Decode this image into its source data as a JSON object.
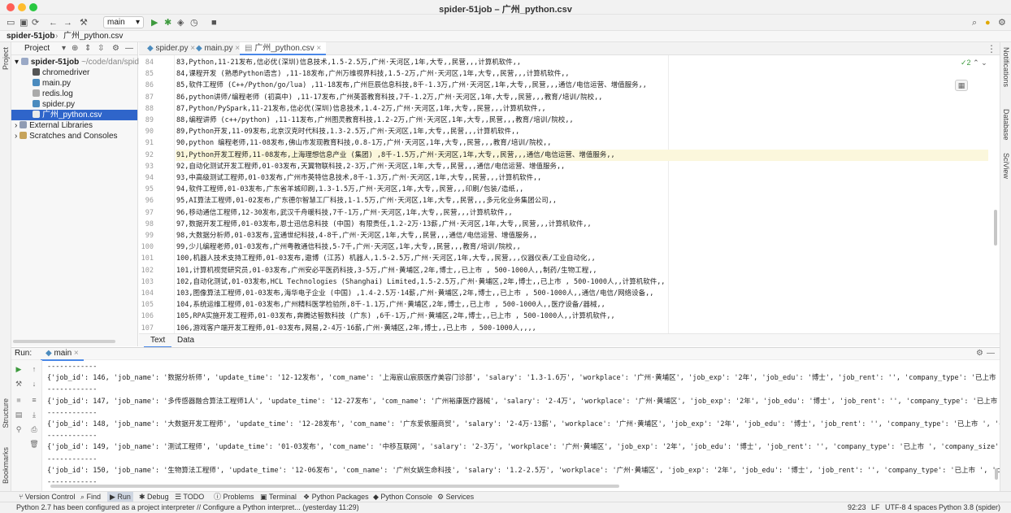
{
  "window": {
    "title": "spider-51job – 广州_python.csv"
  },
  "toolbar": {
    "run_config": "main"
  },
  "nav": {
    "project": "spider-51job",
    "file": "广州_python.csv"
  },
  "left_strip": {
    "project": "Project",
    "structure": "Structure",
    "bookmarks": "Bookmarks"
  },
  "right_strip": {
    "notifications": "Notifications",
    "database": "Database",
    "sciview": "SciView"
  },
  "project_panel": {
    "title": "Project",
    "root": "spider-51job",
    "root_path": "~/code/dan/spider",
    "items": [
      "chromedriver",
      "main.py",
      "redis.log",
      "spider.py",
      "广州_python.csv"
    ],
    "external": "External Libraries",
    "scratches": "Scratches and Consoles"
  },
  "editor": {
    "tabs": [
      "spider.py",
      "main.py",
      "广州_python.csv"
    ],
    "inspection_count": "2",
    "bottom_tabs": [
      "Text",
      "Data"
    ],
    "lines": [
      {
        "n": "84",
        "t": "83,Python,11-21发布,信必优(深圳)信息技术,1.5-2.5万,广州·天河区,1年,大专,,民营,,,计算机软件,,"
      },
      {
        "n": "85",
        "t": "84,课程开发 (熟悉Python语言) ,11-18发布,广州万维视界科技,1.5-2万,广州·天河区,1年,大专,,民营,,,计算机软件,,"
      },
      {
        "n": "86",
        "t": "85,软件工程师 (C++/Python/go/lua) ,11-18发布,广州巨辰信息科技,8千-1.3万,广州·天河区,1年,大专,,民营,,,通信/电信运营、增值服务,,"
      },
      {
        "n": "87",
        "t": "86,python讲师/编程老师 (初高中) ,11-17发布,广州英荟教育科技,7千-1.2万,广州·天河区,1年,大专,,民营,,,教育/培训/院校,,"
      },
      {
        "n": "88",
        "t": "87,Python/PySpark,11-21发布,信必优(深圳)信息技术,1.4-2万,广州·天河区,1年,大专,,民营,,,计算机软件,,"
      },
      {
        "n": "89",
        "t": "88,编程讲师 (c++/python) ,11-11发布,广州图灵教育科技,1.2-2万,广州·天河区,1年,大专,,民营,,,教育/培训/院校,,"
      },
      {
        "n": "90",
        "t": "89,Python开发,11-09发布,北京汉克时代科技,1.3-2.5万,广州·天河区,1年,大专,,民营,,,计算机软件,,"
      },
      {
        "n": "91",
        "t": "90,python 编程老师,11-08发布,佛山市发现教育科技,0.8-1万,广州·天河区,1年,大专,,民营,,,教育/培训/院校,,"
      },
      {
        "n": "92",
        "t": "91,Python开发工程师,11-08发布,上海理想信息产业 (集团) ,8千-1.5万,广州·天河区,1年,大专,,民营,,,通信/电信运营、增值服务,,"
      },
      {
        "n": "93",
        "t": "92,自动化测试开发工程师,01-03发布,天翼物联科技,2-3万,广州·天河区,1年,大专,,民营,,,通信/电信运营、增值服务,,"
      },
      {
        "n": "94",
        "t": "93,中高级测试工程师,01-03发布,广州市英特信息技术,8千-1.3万,广州·天河区,1年,大专,,民营,,,计算机软件,,"
      },
      {
        "n": "95",
        "t": "94,软件工程师,01-03发布,广东省羊城印刷,1.3-1.5万,广州·天河区,1年,大专,,民营,,,印刷/包装/造纸,,"
      },
      {
        "n": "96",
        "t": "95,AI算法工程师,01-02发布,广东德尔智慧工厂科技,1-1.5万,广州·天河区,1年,大专,,民营,,,多元化业务集团公司,,"
      },
      {
        "n": "97",
        "t": "96,移动通信工程师,12-30发布,武汉千舟暖科技,7千-1万,广州·天河区,1年,大专,,民营,,,计算机软件,,"
      },
      {
        "n": "98",
        "t": "97,数据开发工程师,01-03发布,恩士迅信息科技 (中国) 有限责任,1.2-2万·13薪,广州·天河区,1年,大专,,民营,,,计算机软件,,"
      },
      {
        "n": "99",
        "t": "98,大数据分析师,01-03发布,宜通世纪科技,4-8千,广州·天河区,1年,大专,,民营,,,通信/电信运营、增值服务,,"
      },
      {
        "n": "100",
        "t": "99,少儿编程老师,01-03发布,广州粤教通信科技,5-7千,广州·天河区,1年,大专,,民营,,,教育/培训/院校,,"
      },
      {
        "n": "101",
        "t": "100,机器人技术支持工程师,01-03发布,遨博 (江苏) 机器人,1.5-2.5万,广州·天河区,1年,大专,,民营,,,仪器仪表/工业自动化,,"
      },
      {
        "n": "102",
        "t": "101,计算机视觉研究员,01-03发布,广州安必平医药科技,3-5万,广州·黄埔区,2年,博士,,已上市 , 500-1000人,,制药/生物工程,,"
      },
      {
        "n": "103",
        "t": "102,自动化测试,01-03发布,HCL Technologies (Shanghai) Limited,1.5-2.5万,广州·黄埔区,2年,博士,,已上市 , 500-1000人,,计算机软件,,"
      },
      {
        "n": "104",
        "t": "103,图像算法工程师,01-03发布,海华电子企业 (中国) ,1.4-2.5万·14薪,广州·黄埔区,2年,博士,,已上市 , 500-1000人,,通信/电信/网络设备,,"
      },
      {
        "n": "105",
        "t": "104,系统运维工程师,01-03发布,广州精科医学检验所,8千-1.1万,广州·黄埔区,2年,博士,,已上市 , 500-1000人,,医疗设备/器械,,"
      },
      {
        "n": "106",
        "t": "105,RPA实施开发工程师,01-03发布,奔腾达智数科技 (广东) ,6千-1万,广州·黄埔区,2年,博士,,已上市 , 500-1000人,,计算机软件,,"
      },
      {
        "n": "107",
        "t": "106,游戏客户端开发工程师,01-03发布,网易,2-4万·16薪,广州·黄埔区,2年,博士,,已上市 , 500-1000人,,,,"
      }
    ]
  },
  "run_panel": {
    "label": "Run:",
    "config": "main",
    "lines": [
      "------------",
      "{'job_id': 146, 'job_name': '数据分析师', 'update_time': '12-12发布', 'com_name': '上海宸山宸辰医疗美容门诊部', 'salary': '1.3-1.6万', 'workplace': '广州·黄埔区', 'job_exp': '2年', 'job_edu': '博士', 'job_rent': '', 'company_type': '已上市 ',",
      "------------",
      "{'job_id': 147, 'job_name': '多传感器融合算法工程师1人', 'update_time': '12-27发布', 'com_name': '广州裕康医疗器械', 'salary': '2-4万', 'workplace': '广州·黄埔区', 'job_exp': '2年', 'job_edu': '博士', 'job_rent': '', 'company_type': '已上市 '",
      "------------",
      "{'job_id': 148, 'job_name': '大数据开发工程师', 'update_time': '12-28发布', 'com_name': '广东爱依服商贸', 'salary': '2-4万·13薪', 'workplace': '广州·黄埔区', 'job_exp': '2年', 'job_edu': '博士', 'job_rent': '', 'company_type': '已上市 ', 'c",
      "------------",
      "{'job_id': 149, 'job_name': '测试工程师', 'update_time': '01-03发布', 'com_name': '中移互联网', 'salary': '2-3万', 'workplace': '广州·黄埔区', 'job_exp': '2年', 'job_edu': '博士', 'job_rent': '', 'company_type': '已上市 ', 'company_size':",
      "------------",
      "{'job_id': 150, 'job_name': '生物算法工程师', 'update_time': '12-06发布', 'com_name': '广州女娲生命科技', 'salary': '1.2-2.5万', 'workplace': '广州·黄埔区', 'job_exp': '2年', 'job_edu': '博士', 'job_rent': '', 'company_type': '已上市 ', 'co",
      "------------"
    ]
  },
  "bottom_tabs": [
    "Version Control",
    "Find",
    "Run",
    "Debug",
    "TODO",
    "Problems",
    "Terminal",
    "Python Packages",
    "Python Console",
    "Services"
  ],
  "status": {
    "message": "Python 2.7 has been configured as a project interpreter // Configure a Python interpret... (yesterday 11:29)",
    "position": "92:23",
    "line_sep": "LF",
    "encoding": "UTF-8",
    "indent": "4 spaces",
    "interpreter": "Python 3.8 (spider)"
  },
  "colors": {
    "accent": "#2f65ca",
    "tab_underline": "#4a88e8",
    "current_line": "#fbf7dc"
  }
}
